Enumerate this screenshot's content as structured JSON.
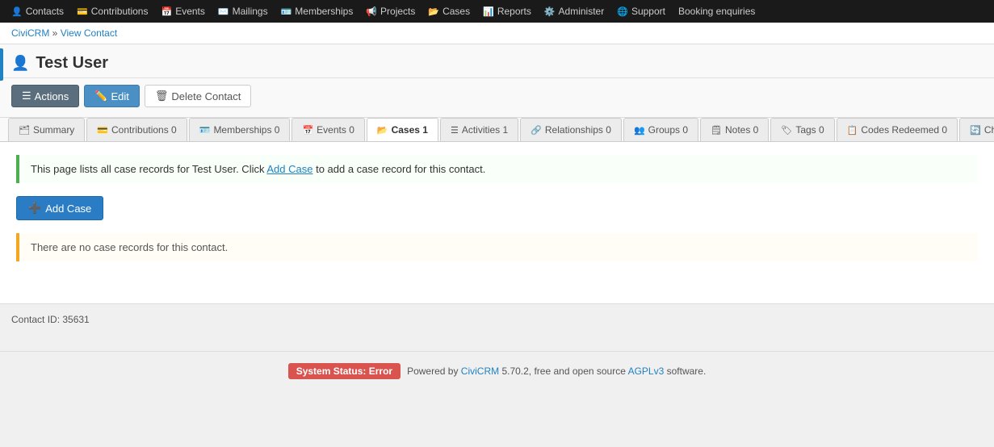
{
  "nav": {
    "items": [
      {
        "label": "Contacts",
        "icon": "👤",
        "id": "contacts"
      },
      {
        "label": "Contributions",
        "icon": "💳",
        "id": "contributions"
      },
      {
        "label": "Events",
        "icon": "📅",
        "id": "events"
      },
      {
        "label": "Mailings",
        "icon": "✉️",
        "id": "mailings"
      },
      {
        "label": "Memberships",
        "icon": "🪪",
        "id": "memberships"
      },
      {
        "label": "Projects",
        "icon": "📢",
        "id": "projects"
      },
      {
        "label": "Cases",
        "icon": "📂",
        "id": "cases"
      },
      {
        "label": "Reports",
        "icon": "📊",
        "id": "reports"
      },
      {
        "label": "Administer",
        "icon": "⚙️",
        "id": "administer"
      },
      {
        "label": "Support",
        "icon": "🌐",
        "id": "support"
      },
      {
        "label": "Booking enquiries",
        "icon": "",
        "id": "booking"
      }
    ]
  },
  "breadcrumb": {
    "crumbs": [
      "CiviCRM",
      "View Contact"
    ],
    "separator": "»"
  },
  "page": {
    "title": "Test User",
    "user_icon": "👤"
  },
  "toolbar": {
    "actions_label": "Actions",
    "edit_label": "Edit",
    "delete_label": "Delete Contact"
  },
  "tabs": [
    {
      "id": "summary",
      "label": "Summary",
      "icon": "🗂",
      "count": null,
      "active": false
    },
    {
      "id": "contributions",
      "label": "Contributions",
      "icon": "💳",
      "count": "0",
      "active": false
    },
    {
      "id": "memberships",
      "label": "Memberships",
      "icon": "🪪",
      "count": "0",
      "active": false
    },
    {
      "id": "events",
      "label": "Events",
      "icon": "📅",
      "count": "0",
      "active": false
    },
    {
      "id": "cases",
      "label": "Cases",
      "icon": "📂",
      "count": "1",
      "active": true
    },
    {
      "id": "activities",
      "label": "Activities",
      "icon": "☰",
      "count": "1",
      "active": false
    },
    {
      "id": "relationships",
      "label": "Relationships",
      "icon": "🔗",
      "count": "0",
      "active": false
    },
    {
      "id": "groups",
      "label": "Groups",
      "icon": "👥",
      "count": "0",
      "active": false
    },
    {
      "id": "notes",
      "label": "Notes",
      "icon": "🗒",
      "count": "0",
      "active": false
    },
    {
      "id": "tags",
      "label": "Tags",
      "icon": "🏷",
      "count": "0",
      "active": false
    },
    {
      "id": "codes-redeemed",
      "label": "Codes Redeemed",
      "icon": "📋",
      "count": "0",
      "active": false
    },
    {
      "id": "ch",
      "label": "Ch",
      "icon": "🔄",
      "count": null,
      "active": false
    }
  ],
  "content": {
    "info_text_before": "This page lists all case records for Test User. Click ",
    "info_link": "Add Case",
    "info_text_after": " to add a case record for this contact.",
    "add_case_label": "Add Case",
    "warning_text": "There are no case records for this contact."
  },
  "footer": {
    "contact_id_label": "Contact ID: 35631"
  },
  "bottom_footer": {
    "status_badge": "System Status: Error",
    "powered_by_prefix": "Powered by ",
    "civicrm_link": "CiviCRM",
    "version": " 5.70.2, free and open source ",
    "agplv3_link": "AGPLv3",
    "suffix": " software."
  }
}
